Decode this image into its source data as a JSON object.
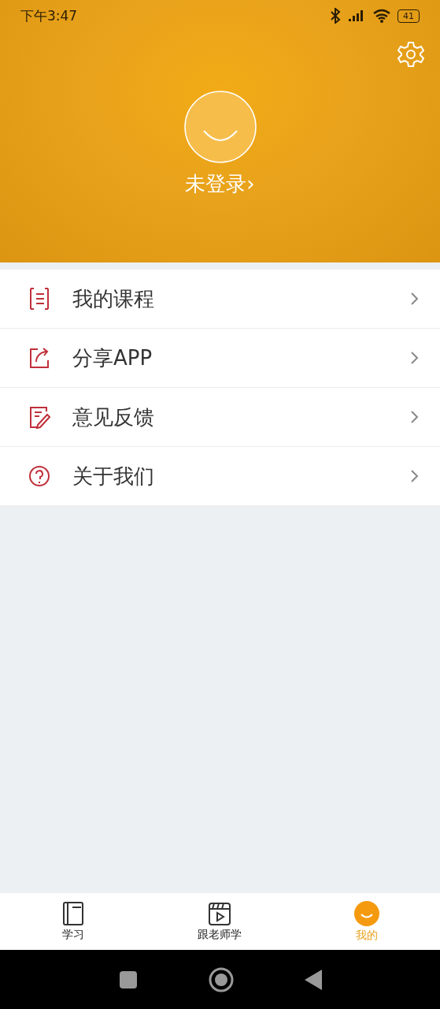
{
  "status_bar": {
    "time": "下午3:47",
    "battery": "41"
  },
  "profile": {
    "login_label": "未登录",
    "chevron": "›"
  },
  "menu": [
    {
      "label": "我的课程",
      "kind": "courses"
    },
    {
      "label": "分享APP",
      "kind": "share"
    },
    {
      "label": "意见反馈",
      "kind": "feedback"
    },
    {
      "label": "关于我们",
      "kind": "about"
    }
  ],
  "tabs": [
    {
      "label": "学习",
      "kind": "book",
      "selected": false
    },
    {
      "label": "跟老师学",
      "kind": "video",
      "selected": false
    },
    {
      "label": "我的",
      "kind": "me",
      "selected": true
    }
  ]
}
